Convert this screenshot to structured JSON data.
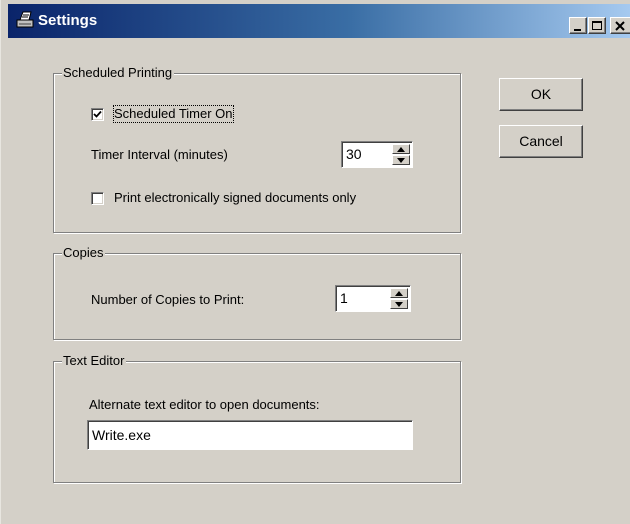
{
  "window": {
    "title": "Settings",
    "icon": "printer-icon",
    "controls": [
      "minimize-icon",
      "maximize-icon",
      "close-icon"
    ]
  },
  "scheduled_printing": {
    "legend": "Scheduled Printing",
    "timer_on_label": "Scheduled Timer On",
    "timer_on_checked": true,
    "interval_label": "Timer Interval (minutes)",
    "interval_value": "30",
    "signed_only_label": "Print electronically signed documents only",
    "signed_only_checked": false
  },
  "copies": {
    "legend": "Copies",
    "count_label": "Number of Copies to Print:",
    "count_value": "1"
  },
  "text_editor": {
    "legend": "Text Editor",
    "editor_label": "Alternate text editor to open documents:",
    "editor_value": "Write.exe"
  },
  "buttons": {
    "ok": "OK",
    "cancel": "Cancel"
  },
  "colors": {
    "face": "#d4d0c8",
    "title_start": "#0a246a",
    "title_end": "#a6caf0"
  }
}
